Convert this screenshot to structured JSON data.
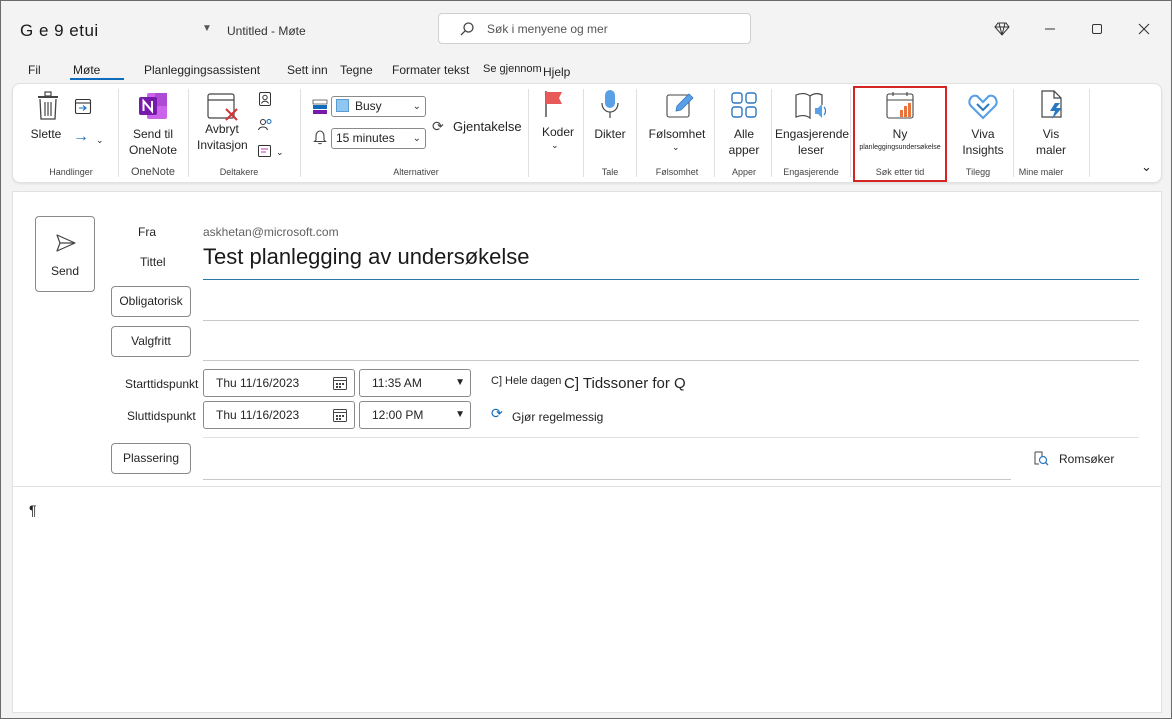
{
  "title_bar": {
    "app_title": "G e 9 etui",
    "document_title": "Untitled  -  Møte",
    "search_placeholder": "Søk i menyene og mer"
  },
  "menu": {
    "tabs": [
      "Fil",
      "Møte",
      "Planleggingsassistent",
      "Sett inn",
      "Tegne",
      "Formater tekst",
      "Se gjennom",
      "Hjelp"
    ],
    "active": "Møte"
  },
  "ribbon": {
    "delete_label": "Slette",
    "group_actions": "Handlinger",
    "onenote_label_1": "Send til",
    "onenote_label_2": "OneNote",
    "group_onenote": "OneNote",
    "cancel_label_1": "Avbryt",
    "cancel_label_2": "Invitasjon",
    "group_attendees": "Deltakere",
    "show_as_value": "Busy",
    "reminder_value": "15 minutes",
    "recurrence_label": "Gjentakelse",
    "group_options": "Alternativer",
    "tags_label": "Koder",
    "dictate_label": "Dikter",
    "group_voice": "Tale",
    "sensitivity_label": "Følsomhet",
    "group_sensitivity": "Følsomhet",
    "all_apps_label_1": "Alle",
    "all_apps_label_2": "apper",
    "group_apps": "Apper",
    "immersive_label_1": "Engasjerende",
    "immersive_label_2": "leser",
    "group_immersive": "Engasjerende",
    "new_poll_label_1": "Ny",
    "new_poll_label_2": "planleggingsundersøkelse",
    "group_find_time": "Søk etter tid",
    "viva_label_1": "Viva",
    "viva_label_2": "Insights",
    "group_addin": "Tilegg",
    "templates_label_1": "Vis",
    "templates_label_2": "maler",
    "group_templates": "Mine maler"
  },
  "compose": {
    "send_label": "Send",
    "from_label": "Fra",
    "from_value": "askhetan@microsoft.com",
    "title_label": "Tittel",
    "title_value": "Test planlegging av undersøkelse",
    "required_label": "Obligatorisk",
    "optional_label": "Valgfritt",
    "start_label": "Starttidspunkt",
    "end_label": "Sluttidspunkt",
    "start_date": "Thu 11/16/2023",
    "start_time": "11:35 AM",
    "end_date": "Thu 11/16/2023",
    "end_time": "12:00 PM",
    "all_day_label": "C] Hele dagen",
    "time_zones_label": "C] Tidssoner for Q",
    "recurring_label": "Gjør regelmessig",
    "location_label": "Plassering",
    "room_finder_label": "Romsøker",
    "body_mark": "¶"
  },
  "colors": {
    "accent": "#0f6cbd",
    "highlight": "#d42424",
    "onenote": "#7719aa"
  }
}
